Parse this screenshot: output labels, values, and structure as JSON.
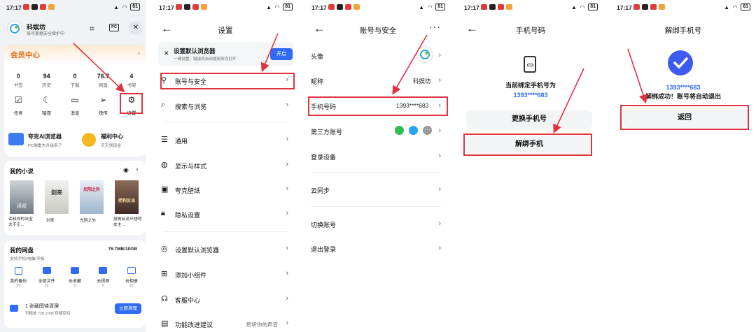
{
  "status": {
    "time": "17:17",
    "battery": "81"
  },
  "p1": {
    "account_name": "科娱坊",
    "account_sub": "账号数据安全保护中",
    "pc_label": "PC",
    "vip_title": "会员中心",
    "stats": [
      {
        "value": "0",
        "label": "书签"
      },
      {
        "value": "94",
        "label": "历史"
      },
      {
        "value": "0",
        "label": "下载"
      },
      {
        "value": "76.7",
        "label": "网盘"
      },
      {
        "value": "4",
        "label": "书架"
      }
    ],
    "tools": [
      "任务",
      "暗夜",
      "消息",
      "快传",
      "设置"
    ],
    "promo1_title": "夸克AI浏览器",
    "promo1_sub": "PC端重大升级来了",
    "promo2_title": "福利中心",
    "promo2_sub": "天天领现金",
    "novel_title": "我的小说",
    "books": [
      "谛叔你的法宝太不正...",
      "剑来",
      "光阴之外",
      "捞狗反派只想苟女主..."
    ],
    "cover_texts": [
      "谛叔",
      "剑来",
      "光阴之外",
      "捞狗反派"
    ],
    "disk_title": "我的网盘",
    "disk_sub": "支持手机/电脑/平板",
    "disk_usage": "76.7MB/10GB",
    "disk_items": [
      {
        "label": "我的备份",
        "count": "29"
      },
      {
        "label": "全部文件",
        "count": "32"
      },
      {
        "label": "云收藏",
        "count": "0"
      },
      {
        "label": "云视频",
        "count": "0"
      },
      {
        "label": "云相册",
        "count": "16"
      }
    ],
    "clean_title": "1 张截图待清理",
    "clean_sub": "可释放 728.3 KB 存储空间",
    "clean_button": "立即清理"
  },
  "p2": {
    "title": "设置",
    "banner_title": "设置默认浏览器",
    "banner_sub": "一键设置，链接将自动使用夸克打开",
    "banner_button": "开启",
    "items": [
      "账号与安全",
      "搜索与浏览",
      "通用",
      "显示与样式",
      "夸克壁纸",
      "隐私设置",
      "设置默认浏览器",
      "添加小组件",
      "客服中心",
      "功能改进建议"
    ],
    "feedback_hint": "聆听你的声音"
  },
  "p3": {
    "title": "账号与安全",
    "rows": [
      "头像",
      "昵称",
      "手机号码",
      "第三方账号",
      "登录设备",
      "云同步",
      "切换账号",
      "退出登录"
    ],
    "nickname": "科娱坊",
    "phone": "1393****683"
  },
  "p4": {
    "title": "手机号码",
    "bound_label": "当前绑定手机号为",
    "phone": "1393****683",
    "change_button": "更换手机号",
    "unbind_button": "解绑手机"
  },
  "p5": {
    "title": "解绑手机号",
    "phone": "1393****683",
    "success_text": "解绑成功！账号将自动退出",
    "back_button": "返回"
  },
  "colors": {
    "accent_blue": "#2f6bf5",
    "highlight_red": "#e0333e",
    "vip_orange": "#e8701a"
  }
}
